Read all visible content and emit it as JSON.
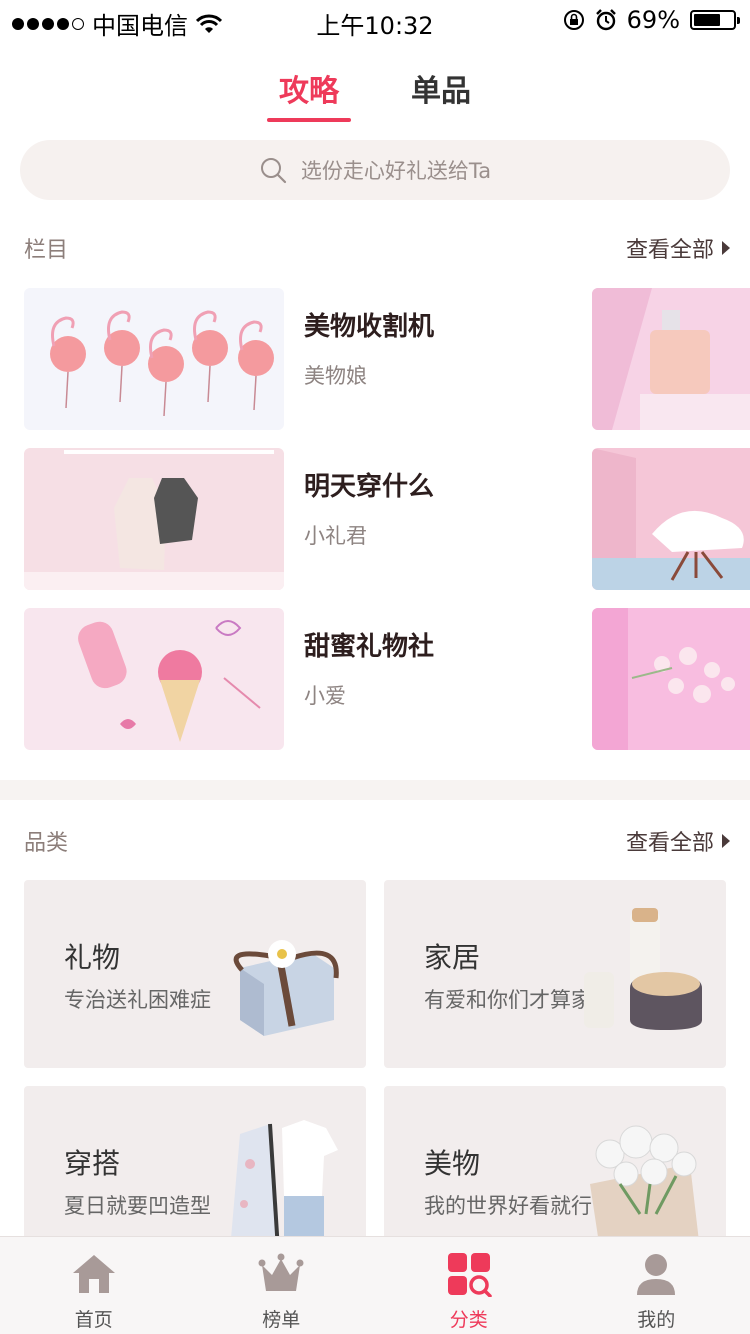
{
  "status_bar": {
    "carrier": "中国电信",
    "time": "上午10:32",
    "battery": "69%",
    "battery_level": 0.69
  },
  "top_tabs": [
    {
      "label": "攻略",
      "active": true
    },
    {
      "label": "单品",
      "active": false
    }
  ],
  "search": {
    "placeholder": "选份走心好礼送给Ta",
    "icon": "search-icon"
  },
  "columns_section": {
    "title": "栏目",
    "view_all": "查看全部",
    "items": [
      {
        "title": "美物收割机",
        "author": "美物娘"
      },
      {
        "title": "明天穿什么",
        "author": "小礼君"
      },
      {
        "title": "甜蜜礼物社",
        "author": "小爱"
      }
    ]
  },
  "category_section": {
    "title": "品类",
    "view_all": "查看全部",
    "items": [
      {
        "title": "礼物",
        "subtitle": "专治送礼困难症"
      },
      {
        "title": "家居",
        "subtitle": "有爱和你们才算家"
      },
      {
        "title": "穿搭",
        "subtitle": "夏日就要凹造型"
      },
      {
        "title": "美物",
        "subtitle": "我的世界好看就行"
      }
    ]
  },
  "tabbar": [
    {
      "label": "首页",
      "icon": "home-icon",
      "active": false
    },
    {
      "label": "榜单",
      "icon": "crown-icon",
      "active": false
    },
    {
      "label": "分类",
      "icon": "category-icon",
      "active": true
    },
    {
      "label": "我的",
      "icon": "profile-icon",
      "active": false
    }
  ],
  "colors": {
    "accent": "#ee3a5a",
    "icon_gray": "#a89a98",
    "card_bg": "#f2eded"
  }
}
